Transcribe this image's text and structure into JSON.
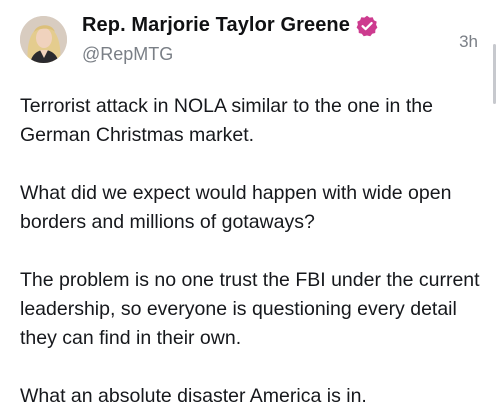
{
  "post": {
    "author": {
      "display_name": "Rep. Marjorie Taylor Greene",
      "handle": "@RepMTG",
      "verified": true,
      "avatar_icon": "avatar-photo"
    },
    "timestamp": "3h",
    "paragraphs": [
      "Terrorist attack in NOLA similar to the one in the German Christmas market.",
      "What did we expect would happen with wide open borders and millions of gotaways?",
      "The problem is no one trust the FBI under the current leadership, so everyone is questioning every detail they can find in their own.",
      "What an absolute disaster America is in."
    ]
  },
  "colors": {
    "verified_badge": "#cd3b8f",
    "secondary_text": "#7a7f86",
    "primary_text": "#16181c"
  }
}
